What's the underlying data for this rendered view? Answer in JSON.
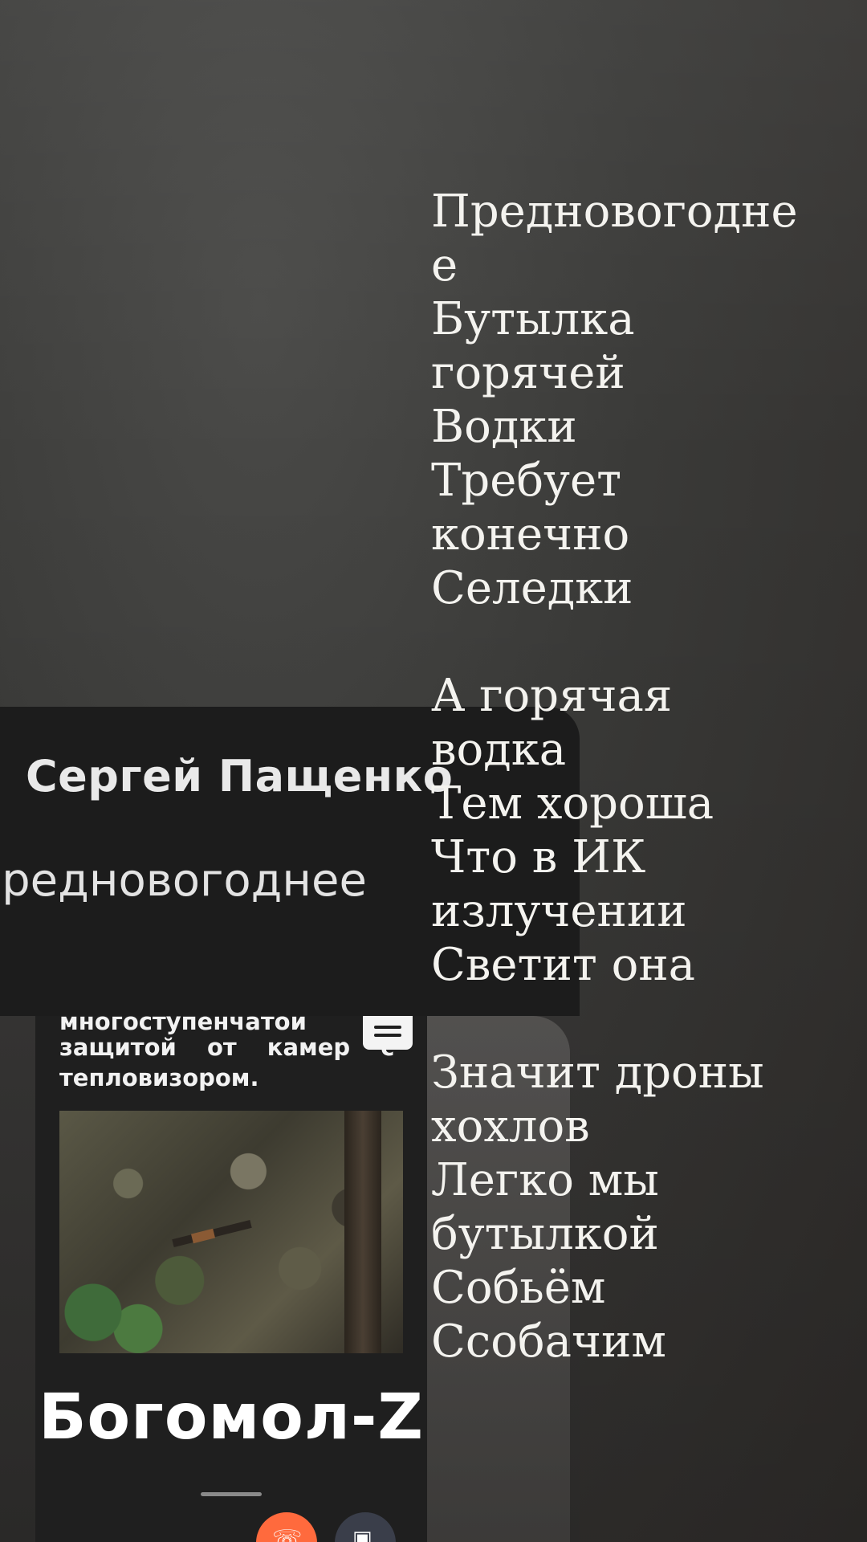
{
  "notification": {
    "sender": "Сергей Пащенко",
    "preview": "Предновогоднее"
  },
  "attachment": {
    "text_line1": "многоступенчатой",
    "text_line2": "защитой от камер с",
    "text_line3": "тепловизором.",
    "product_title": "Богомол-Z",
    "icons": [
      "chat-icon",
      "phone-icon",
      "info-icon"
    ]
  },
  "poem": {
    "stanzas": [
      [
        "Предновогодне",
        "е",
        "Бутылка",
        "горячей",
        "Водки",
        "Требует",
        "конечно",
        "Селедки"
      ],
      [
        "А горячая",
        "водка",
        "Тем хороша",
        "Что в ИК",
        "излучении",
        "Светит она"
      ],
      [
        "Значит дроны",
        "хохлов",
        "Легко мы",
        "бутылкой",
        "Собьём",
        "Ссобачим"
      ]
    ]
  },
  "colors": {
    "accent_call": "#ff6a3d",
    "card": "#1c1c1c",
    "text": "#f4f3ef"
  }
}
